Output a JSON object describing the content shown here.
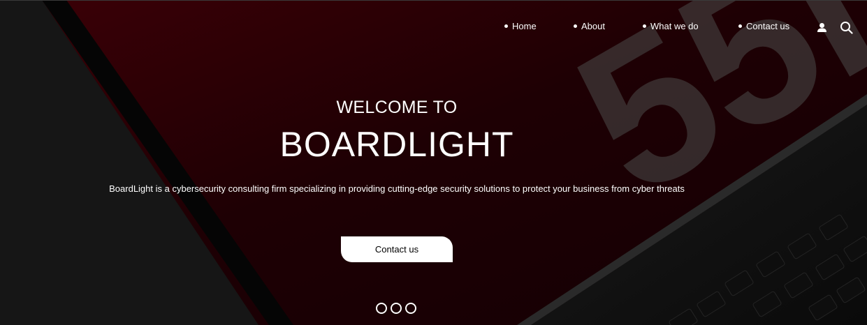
{
  "nav": {
    "items": [
      {
        "label": "Home"
      },
      {
        "label": "About"
      },
      {
        "label": "What we do"
      },
      {
        "label": "Contact us"
      }
    ],
    "icons": [
      "user-icon",
      "search-icon"
    ]
  },
  "hero": {
    "welcome": "WELCOME TO",
    "title": "BOARDLIGHT",
    "description": "BoardLight is a cybersecurity consulting firm specializing in providing cutting-edge security solutions to protect your business from cyber threats",
    "cta_label": "Contact us",
    "background_watermark": "55I"
  },
  "carousel": {
    "slide_count": 3
  },
  "colors": {
    "accent_red": "#5a0008",
    "text": "#ffffff",
    "dark": "#111111"
  }
}
